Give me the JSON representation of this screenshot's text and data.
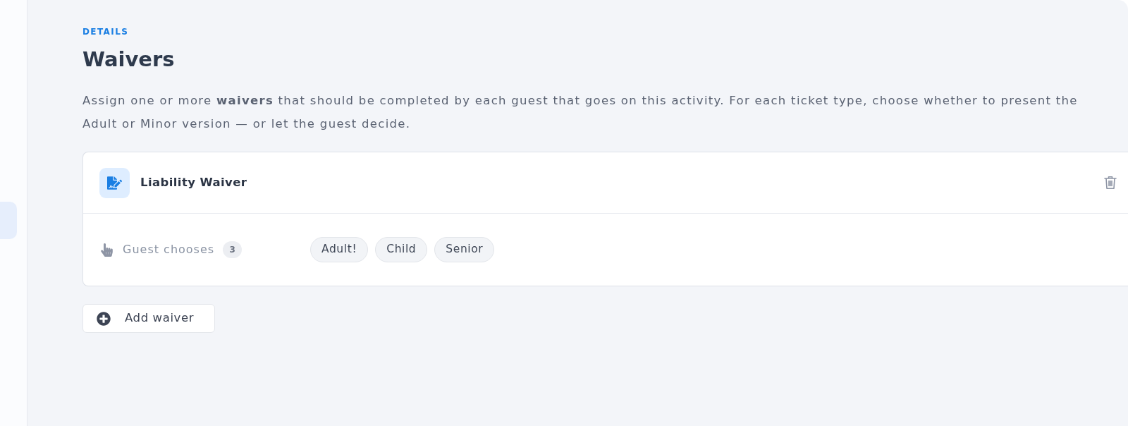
{
  "sidebar": {
    "items": [
      {
        "selected": true
      }
    ]
  },
  "header": {
    "eyebrow": "DETAILS",
    "title": "Waivers",
    "description_lines": [
      "Assign one or more **waivers** that should be completed by each guest that goes on this activity. For each ticket type, choose whether to present the",
      "Adult or Minor version — or let the guest decide."
    ]
  },
  "waivers": [
    {
      "name": "Liability Waiver",
      "mode": {
        "label": "Guest chooses",
        "count": "3"
      },
      "ticket_types": [
        "Adult!",
        "Child",
        "Senior"
      ]
    }
  ],
  "add_button": {
    "label": "Add waiver"
  }
}
